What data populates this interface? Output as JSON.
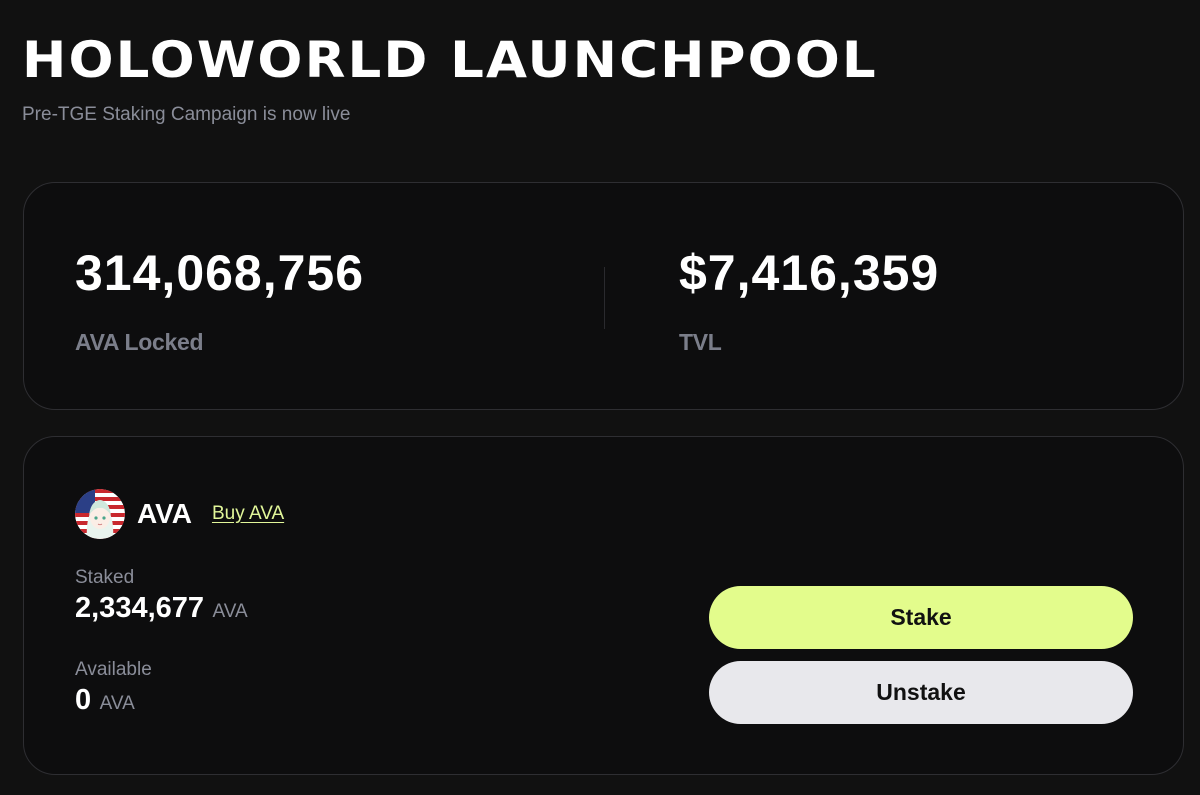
{
  "header": {
    "title": "HOLOWORLD LAUNCHPOOL",
    "subtitle": "Pre-TGE Staking Campaign is now live"
  },
  "stats": {
    "locked": {
      "value": "314,068,756",
      "label": "AVA Locked"
    },
    "tvl": {
      "value": "$7,416,359",
      "label": "TVL"
    }
  },
  "pool": {
    "token_name": "AVA",
    "avatar_icon": "ava-avatar-icon",
    "buy_link": "Buy AVA",
    "staked": {
      "label": "Staked",
      "value": "2,334,677",
      "unit": "AVA"
    },
    "available": {
      "label": "Available",
      "value": "0",
      "unit": "AVA"
    },
    "stake_label": "Stake",
    "unstake_label": "Unstake"
  },
  "colors": {
    "background": "#111111",
    "card": "#0d0d0e",
    "accent": "#e3fc8c",
    "muted_text": "#8a8d99",
    "secondary_button": "#e8e8ec"
  }
}
